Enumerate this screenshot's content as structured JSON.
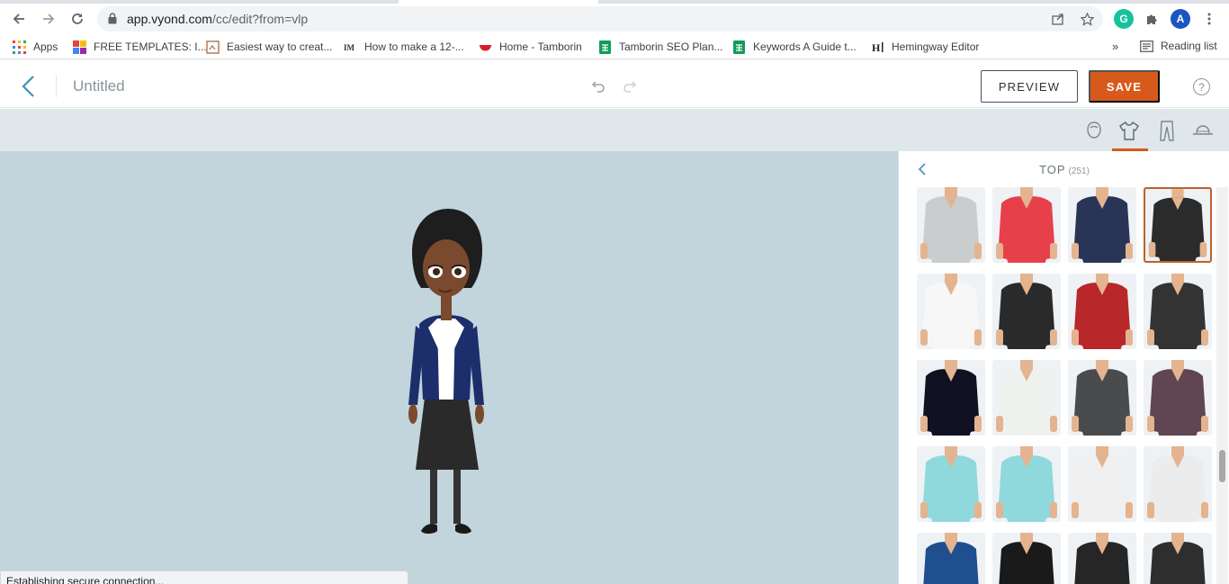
{
  "browser": {
    "url_host": "app.vyond.com",
    "url_path": "/cc/edit?from=vlp",
    "profile_initial": "A",
    "grammarly_initial": "G",
    "bookmarks": [
      {
        "label": "Apps",
        "icon": "apps-grid-icon"
      },
      {
        "label": "FREE TEMPLATES: I...",
        "icon": "templates-favicon"
      },
      {
        "label": "Easiest way to creat...",
        "icon": "page-favicon"
      },
      {
        "label": "How to make a 12-...",
        "icon": "im-favicon"
      },
      {
        "label": "Home - Tamborin",
        "icon": "tamborin-favicon"
      },
      {
        "label": "Tamborin SEO Plan...",
        "icon": "sheets-favicon"
      },
      {
        "label": "Keywords A Guide t...",
        "icon": "sheets-favicon"
      },
      {
        "label": "Hemingway Editor",
        "icon": "hemingway-favicon"
      }
    ],
    "more_label": "»",
    "reading_list_label": "Reading list",
    "status_text": "Establishing secure connection..."
  },
  "header": {
    "title": "Untitled",
    "preview_label": "PREVIEW",
    "save_label": "SAVE",
    "help_label": "?"
  },
  "categories": [
    {
      "name": "head",
      "icon": "head-icon",
      "active": false
    },
    {
      "name": "top",
      "icon": "shirt-icon",
      "active": true
    },
    {
      "name": "bottom",
      "icon": "pants-icon",
      "active": false
    },
    {
      "name": "hat",
      "icon": "hat-icon",
      "active": false
    }
  ],
  "panel": {
    "title": "TOP",
    "count": "(251)",
    "items": [
      {
        "name": "grey-scrub-shirt",
        "color": "#c9cdcd",
        "selected": false
      },
      {
        "name": "red-polo-shirt",
        "color": "#e8404b",
        "selected": false
      },
      {
        "name": "navy-blazer",
        "color": "#2a3457",
        "selected": false
      },
      {
        "name": "black-blazer",
        "color": "#2b2b2b",
        "selected": true
      },
      {
        "name": "white-blouse",
        "color": "#f7f7f7",
        "selected": false
      },
      {
        "name": "graduation-gown",
        "color": "#2a2a2a",
        "selected": false
      },
      {
        "name": "red-bellhop-jacket",
        "color": "#b8272a",
        "selected": false
      },
      {
        "name": "black-waistcoat",
        "color": "#333333",
        "selected": false
      },
      {
        "name": "police-uniform",
        "color": "#111122",
        "selected": false
      },
      {
        "name": "white-robe",
        "color": "#eef2ee",
        "selected": false
      },
      {
        "name": "grey-work-shirt",
        "color": "#4a4b4d",
        "selected": false
      },
      {
        "name": "maroon-work-shirt",
        "color": "#5f4650",
        "selected": false
      },
      {
        "name": "teal-scrubs-stethoscope",
        "color": "#8fd9dc",
        "selected": false
      },
      {
        "name": "teal-scrubs-stethoscope-2",
        "color": "#8fd9dc",
        "selected": false
      },
      {
        "name": "white-coat-stethoscope",
        "color": "#f0f0f0",
        "selected": false
      },
      {
        "name": "white-coat-stethoscope-2",
        "color": "#ececec",
        "selected": false
      },
      {
        "name": "blue-football-jersey",
        "color": "#1f4f8f",
        "selected": false
      },
      {
        "name": "black-tshirt-badge",
        "color": "#1a1a1a",
        "selected": false
      },
      {
        "name": "black-suit-badge",
        "color": "#262626",
        "selected": false
      },
      {
        "name": "black-vest-tie",
        "color": "#2e2e2e",
        "selected": false
      }
    ]
  },
  "character": {
    "skin": "#7a4a2e",
    "hair": "#1e1e1e",
    "blazer": "#1c2e6b",
    "skirt": "#2a2a2a",
    "shirt": "#ffffff"
  }
}
